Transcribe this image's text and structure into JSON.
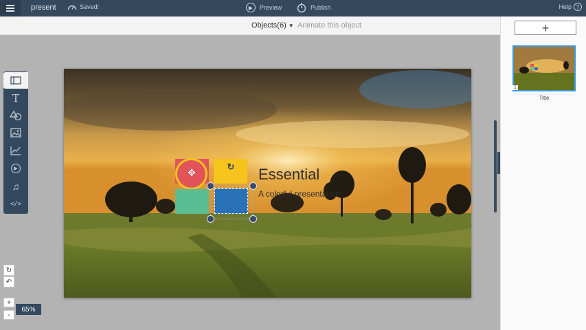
{
  "topbar": {
    "menu_icon": "hamburger-icon",
    "presentation_name": "present",
    "saved_label": "Saved!",
    "preview_label": "Preview",
    "publish_label": "Publish",
    "help_label": "Help"
  },
  "objbar": {
    "objects_label": "Objects(6)",
    "animate_label": "Animate this object"
  },
  "slide": {
    "title": "Essential",
    "subtitle": "A colorful presentation",
    "colors": {
      "red": "#e0545a",
      "yellow": "#f7c31d",
      "green": "#5bbd93",
      "blue": "#2a72b8"
    }
  },
  "rpanel": {
    "add_icon": "plus-icon",
    "thumb_number": "1",
    "thumb_label": "Title"
  },
  "tools": [
    "layout-icon",
    "text-icon",
    "shapes-icon",
    "image-icon",
    "chart-icon",
    "video-icon",
    "music-icon",
    "code-icon"
  ],
  "code_label": "</>",
  "zoom": {
    "value": "65%",
    "plus": "+",
    "minus": "-"
  }
}
